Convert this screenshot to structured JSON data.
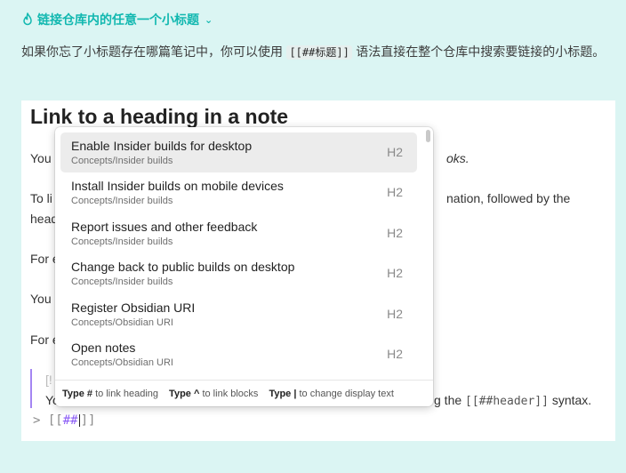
{
  "callout": {
    "title": "链接仓库内的任意一个小标题",
    "desc_before": "如果你忘了小标题存在哪篇笔记中，你可以使用",
    "desc_code": "[[##标题]]",
    "desc_after": "语法直接在整个仓库中搜索要链接的小标题。"
  },
  "note": {
    "heading": "Link to a heading in a note",
    "lines": [
      {
        "left": "You",
        "right": "oks."
      },
      {
        "left": "To li",
        "right": "nation, followed by the"
      },
      {
        "left": "head"
      },
      {
        "left": "For e"
      },
      {
        "left": "You"
      },
      {
        "left": "For e"
      }
    ],
    "quote_faint": "[!",
    "quote_left": "Yo",
    "quote_right_prefix": "g the",
    "quote_code": "[[##header]]",
    "quote_right_suffix": "syntax.",
    "cursor_prefix": "> [[",
    "cursor_hash": "##",
    "cursor_suffix": "]]"
  },
  "popup": {
    "suggestions": [
      {
        "title": "Enable Insider builds for desktop",
        "path": "Concepts/Insider builds",
        "level": "H2",
        "selected": true
      },
      {
        "title": "Install Insider builds on mobile devices",
        "path": "Concepts/Insider builds",
        "level": "H2"
      },
      {
        "title": "Report issues and other feedback",
        "path": "Concepts/Insider builds",
        "level": "H2"
      },
      {
        "title": "Change back to public builds on desktop",
        "path": "Concepts/Insider builds",
        "level": "H2"
      },
      {
        "title": "Register Obsidian URI",
        "path": "Concepts/Obsidian URI",
        "level": "H2"
      },
      {
        "title": "Open notes",
        "path": "Concepts/Obsidian URI",
        "level": "H2"
      }
    ],
    "footer": [
      {
        "key": "Type #",
        "text": "to link heading"
      },
      {
        "key": "Type ^",
        "text": "to link blocks"
      },
      {
        "key": "Type |",
        "text": "to change display text"
      }
    ]
  }
}
